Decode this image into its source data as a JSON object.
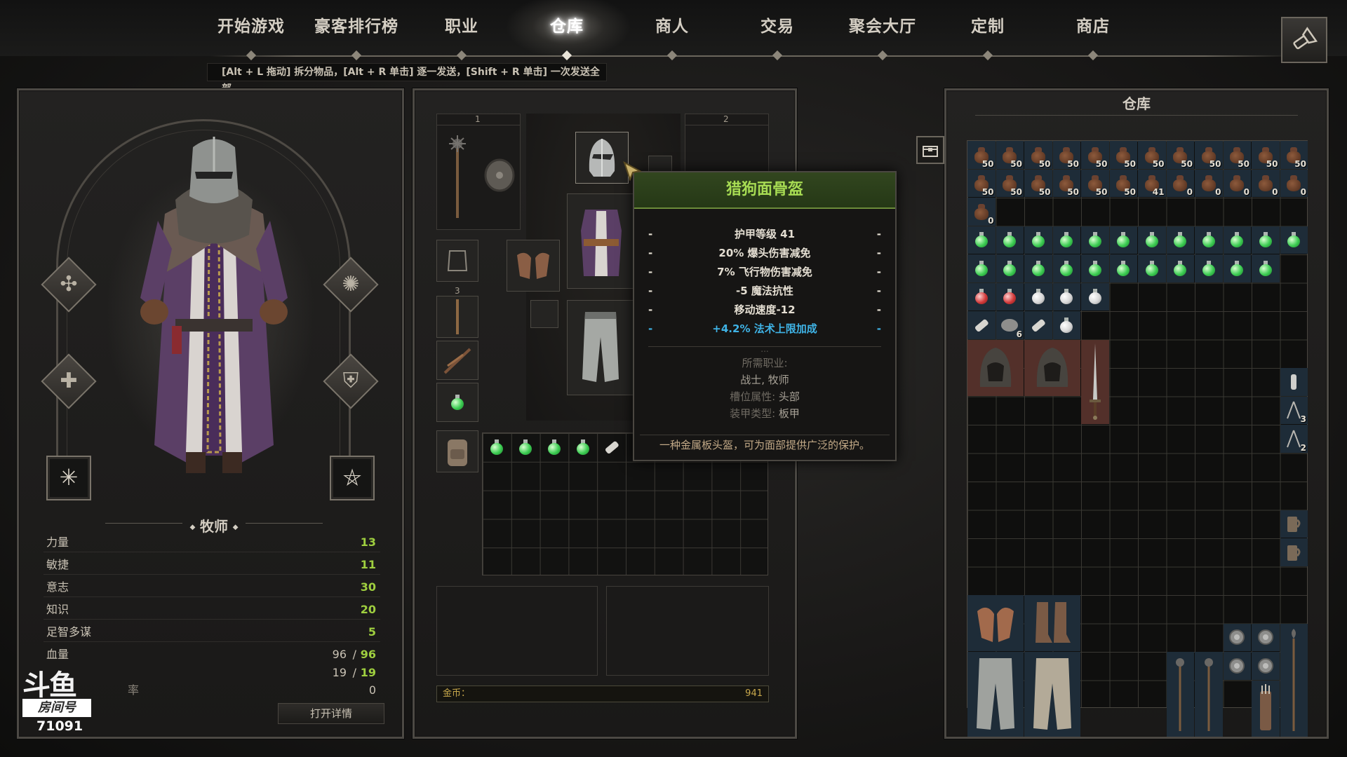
{
  "nav": {
    "items": [
      "开始游戏",
      "豪客排行榜",
      "职业",
      "仓库",
      "商人",
      "交易",
      "聚会大厅",
      "定制",
      "商店"
    ],
    "active_index": 3
  },
  "hint": "[Alt + L 拖动] 拆分物品，[Alt + R 单击] 逐一发送，[Shift + R 单击] 一次发送全部",
  "character": {
    "class_name": "牧师",
    "stats": [
      {
        "label": "力量",
        "value": "13"
      },
      {
        "label": "敏捷",
        "value": "11"
      },
      {
        "label": "意志",
        "value": "30"
      },
      {
        "label": "知识",
        "value": "20"
      },
      {
        "label": "足智多谋",
        "value": "5"
      }
    ],
    "health": {
      "label": "血量",
      "current": "96",
      "max": "96"
    },
    "second_resource": {
      "current": "19",
      "max": "19"
    },
    "third_stat_value": "0",
    "third_stat_label_partial": "率",
    "detail_button": "打开详情"
  },
  "equipment": {
    "slot_numbers": [
      "1",
      "2",
      "3"
    ],
    "gold_label": "金币：",
    "gold_value": "941"
  },
  "tooltip": {
    "name": "猎狗面骨盔",
    "stats": [
      {
        "text": "护甲等级 41",
        "color": "white"
      },
      {
        "text": "20% 爆头伤害减免",
        "color": "white"
      },
      {
        "text": "7% 飞行物伤害减免",
        "color": "white"
      },
      {
        "text": "-5 魔法抗性",
        "color": "white"
      },
      {
        "text": "移动速度-12",
        "color": "white"
      },
      {
        "text": "+4.2% 法术上限加成",
        "color": "blue"
      }
    ],
    "dots": "...",
    "required_class_label": "所需职业:",
    "required_classes": "战士, 牧师",
    "slot_label": "槽位属性:",
    "slot_value": "头部",
    "armor_type_label": "装甲类型:",
    "armor_type_value": "板甲",
    "description": "一种金属板头盔，可为面部提供广泛的保护。"
  },
  "stash": {
    "title": "仓库",
    "bag_counts_row1": [
      "50",
      "50",
      "50",
      "50",
      "50",
      "50",
      "50",
      "50",
      "50",
      "50",
      "50",
      "50"
    ],
    "bag_counts_row2": [
      "50",
      "50",
      "50",
      "50",
      "50",
      "50",
      "41",
      "0",
      "0",
      "0",
      "0",
      "0"
    ],
    "bag_counts_row3": [
      "0"
    ],
    "misc_counts": {
      "disc": "6",
      "tool1": "3",
      "tool2": "2"
    }
  },
  "watermark": {
    "logo_text": "斗鱼",
    "room_label": "房间号",
    "room_number": "71091"
  },
  "colors": {
    "accent_green": "#9fcf3f",
    "tooltip_header": "#253816",
    "tooltip_title": "#a7dc53",
    "blue_stat": "#3fb3e6",
    "gold": "#c9a94c"
  }
}
